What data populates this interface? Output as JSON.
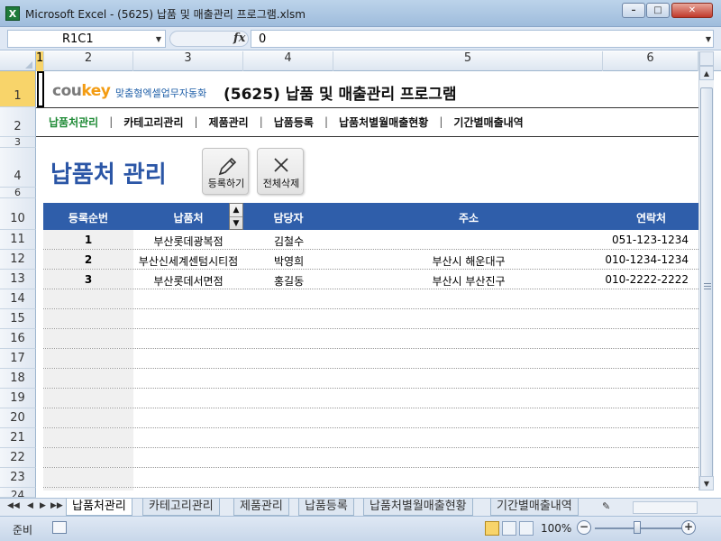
{
  "window": {
    "app_icon_letter": "X",
    "title": "Microsoft Excel - (5625) 납품 및 매출관리 프로그램.xlsm",
    "min": "–",
    "max": "□",
    "close": "✕"
  },
  "formula_bar": {
    "name_box": "R1C1",
    "fx": "fx",
    "value": "0"
  },
  "columns": [
    "1",
    "2",
    "3",
    "4",
    "5",
    "6"
  ],
  "rows": [
    "1",
    "2",
    "3",
    "4",
    "6",
    "10",
    "11",
    "12",
    "13",
    "14",
    "15",
    "16",
    "17",
    "18",
    "19",
    "20",
    "21",
    "22",
    "23",
    "24"
  ],
  "brand": {
    "logo_main": "cou",
    "logo_accent": "key",
    "logo_sub": "맞춤형엑셀업무자동화",
    "program_title": "(5625) 납품 및 매출관리 프로그램"
  },
  "nav": {
    "items": [
      "납품처관리",
      "카테고리관리",
      "제품관리",
      "납품등록",
      "납품처별월매출현황",
      "기간별매출내역"
    ],
    "separator": "|"
  },
  "page_heading": "납품처 관리",
  "actions": {
    "register_label": "등록하기",
    "delete_all_label": "전체삭제"
  },
  "table": {
    "headers": [
      "등록순번",
      "납품처",
      "담당자",
      "주소",
      "연락처"
    ],
    "sort_up": "▲",
    "sort_down": "▼",
    "rows": [
      {
        "no": "1",
        "vendor": "부산롯데광복점",
        "manager": "김철수",
        "address": "",
        "phone": "051-123-1234"
      },
      {
        "no": "2",
        "vendor": "부산신세계센텀시티점",
        "manager": "박영희",
        "address": "부산시 해운대구",
        "phone": "010-1234-1234"
      },
      {
        "no": "3",
        "vendor": "부산롯데서면점",
        "manager": "홍길동",
        "address": "부산시 부산진구",
        "phone": "010-2222-2222"
      }
    ]
  },
  "sheet_tabs": [
    "납품처관리",
    "카테고리관리",
    "제품관리",
    "납품등록",
    "납품처별월매출현황",
    "기간별매출내역"
  ],
  "status": {
    "ready": "준비",
    "zoom": "100%",
    "zoom_minus": "−",
    "zoom_plus": "+"
  },
  "colors": {
    "header_blue": "#2f5eaa",
    "heading_blue": "#2b56a6",
    "nav_active_green": "#1e8a35",
    "selection_yellow": "#f8d46a"
  }
}
